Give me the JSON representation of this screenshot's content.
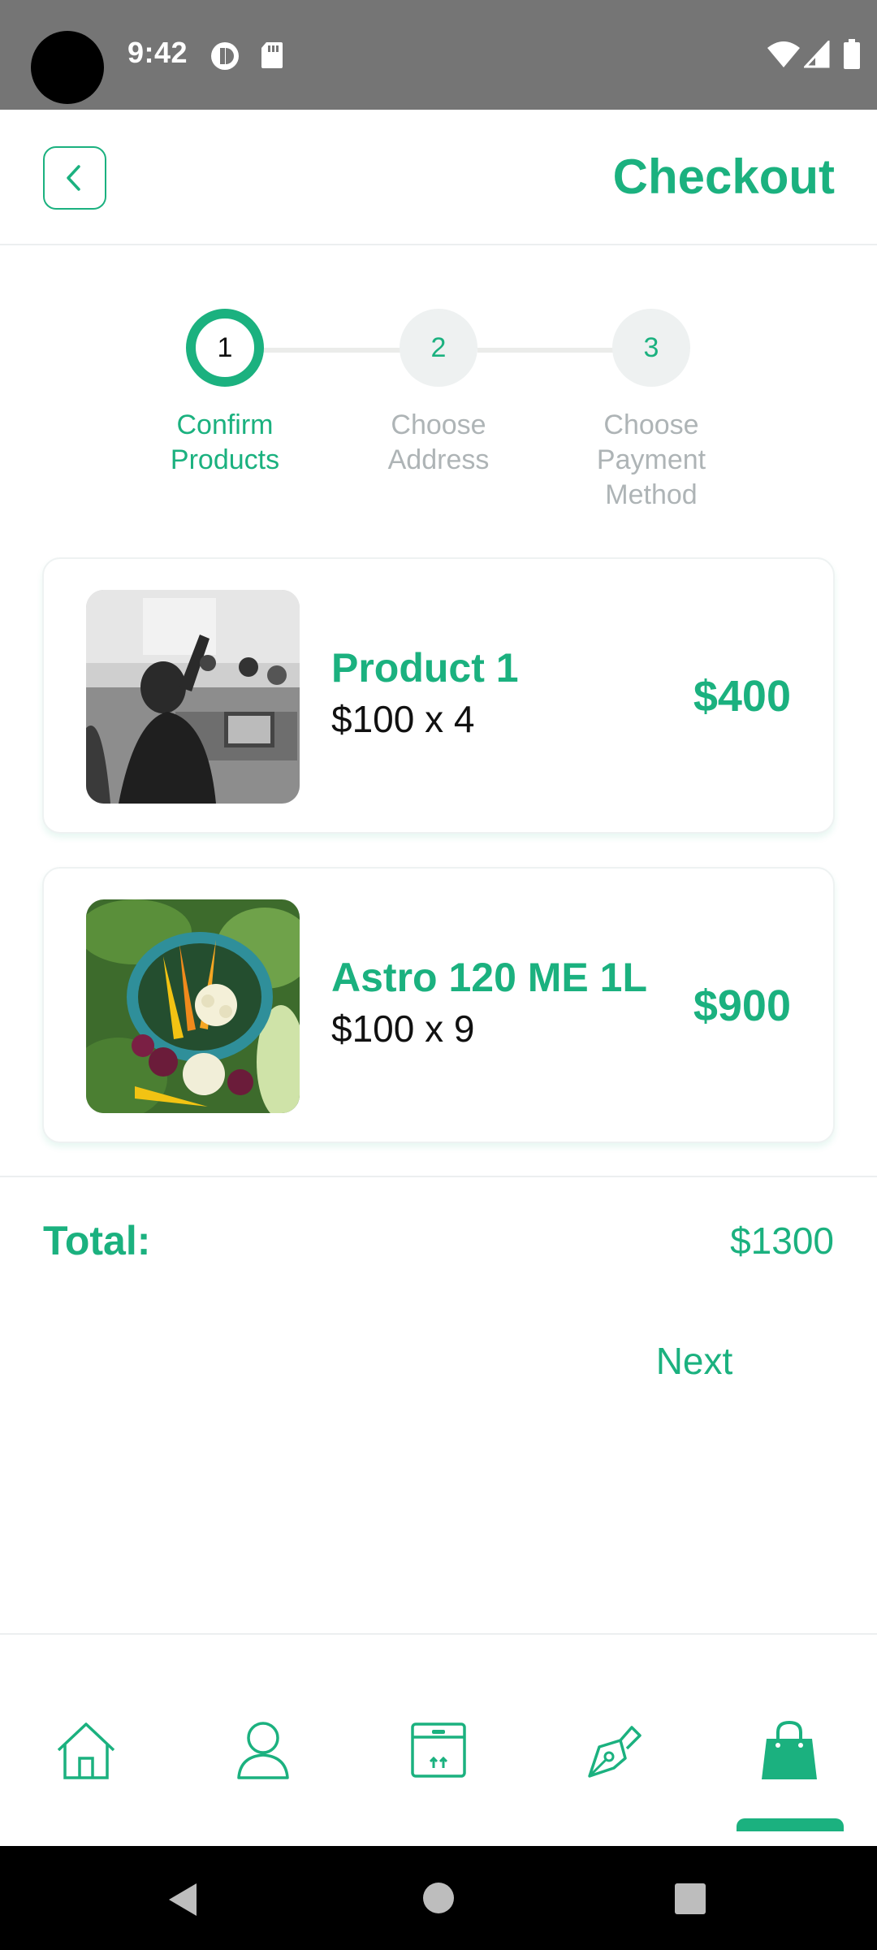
{
  "status_bar": {
    "time": "9:42",
    "icons": [
      "notification-app-icon",
      "sd-card-icon",
      "wifi-icon",
      "cellular-signal-icon",
      "battery-icon"
    ]
  },
  "header": {
    "title": "Checkout",
    "back_icon": "chevron-left-icon"
  },
  "stepper": {
    "steps": [
      {
        "number": "1",
        "label_line1": "Confirm",
        "label_line2": "Products",
        "label_line3": "",
        "active": true
      },
      {
        "number": "2",
        "label_line1": "Choose",
        "label_line2": "Address",
        "label_line3": "",
        "active": false
      },
      {
        "number": "3",
        "label_line1": "Choose",
        "label_line2": "Payment",
        "label_line3": "Method",
        "active": false
      }
    ]
  },
  "products": [
    {
      "name": "Product 1",
      "price_qty": "$100 x 4",
      "total": "$400"
    },
    {
      "name": "Astro 120 ME 1L",
      "price_qty": "$100 x 9",
      "total": "$900"
    }
  ],
  "summary": {
    "total_label": "Total:",
    "total_value": "$1300",
    "next_label": "Next"
  },
  "bottom_nav": {
    "items": [
      "home-icon",
      "profile-icon",
      "box-icon",
      "pen-icon",
      "shopping-bag-icon"
    ],
    "active_index": 4
  },
  "colors": {
    "accent": "#1bb17f",
    "status_bar": "#757575",
    "inactive_text": "#aeb4b6",
    "step_inactive_bg": "#eef1f1"
  }
}
